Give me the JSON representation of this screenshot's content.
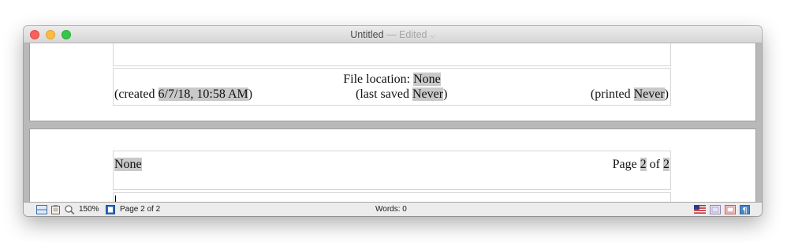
{
  "window": {
    "title": "Untitled",
    "title_separator": "—",
    "edited_label": "Edited",
    "title_menu_icon": "chevron-down-icon",
    "traffic_lights": {
      "close": "#fc605b",
      "minimize": "#fdbc40",
      "zoom": "#34c84a"
    }
  },
  "document": {
    "page1_footer": {
      "file_location_label": "File location: ",
      "file_location_value": "None",
      "created_prefix": "(created ",
      "created_value": "6/7/18, 10:58 AM",
      "created_suffix": ")",
      "last_saved_prefix": "(last saved ",
      "last_saved_value": "Never",
      "last_saved_suffix": ")",
      "printed_prefix": "(printed ",
      "printed_value": "Never",
      "printed_suffix": ")"
    },
    "page2_header": {
      "left_value": "None",
      "page_prefix": "Page ",
      "page_number": "2",
      "page_of": " of ",
      "page_total": "2"
    }
  },
  "statusbar": {
    "icons": [
      "layout-view-icon",
      "document-icon",
      "magnifier-icon",
      "page-icon",
      "us-flag-icon",
      "document-properties-icon",
      "spelling-icon",
      "invisibles-icon"
    ],
    "zoom": "150%",
    "page_indicator": "Page 2 of 2",
    "word_count": "Words: 0"
  },
  "colors": {
    "field_highlight": "#c9c9c9",
    "canvas_background": "#b9b9b9",
    "page_background": "#ffffff",
    "statusbar_background": "#ececec"
  }
}
